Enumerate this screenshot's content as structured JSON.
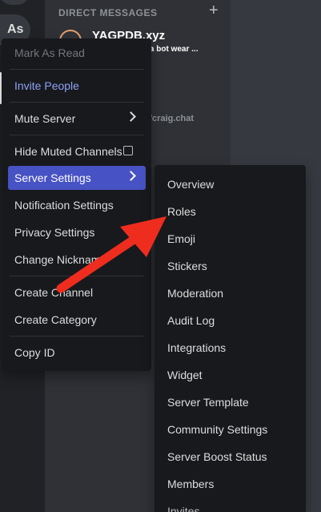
{
  "server_rail": {
    "server_initials": "As"
  },
  "dm_panel": {
    "header": "DIRECT MESSAGES",
    "add_icon": "plus-icon",
    "dm_name": "YAGPDB.xyz",
    "dm_status": "es a bot wear ...",
    "dm_link": "/craig.chat"
  },
  "context_menu": {
    "items": [
      {
        "label": "Mark As Read",
        "state": "disabled"
      },
      {
        "label": "Invite People",
        "state": "accent"
      },
      {
        "label": "Mute Server",
        "state": "normal",
        "trailing": "chevron-right-icon"
      },
      {
        "label": "Hide Muted Channels",
        "state": "normal",
        "trailing": "checkbox"
      },
      {
        "label": "Server Settings",
        "state": "active",
        "trailing": "chevron-right-icon"
      },
      {
        "label": "Notification Settings",
        "state": "normal"
      },
      {
        "label": "Privacy Settings",
        "state": "normal"
      },
      {
        "label": "Change Nickname",
        "state": "normal"
      },
      {
        "label": "Create Channel",
        "state": "normal"
      },
      {
        "label": "Create Category",
        "state": "normal"
      },
      {
        "label": "Copy ID",
        "state": "normal"
      }
    ]
  },
  "server_settings_submenu": {
    "items": [
      "Overview",
      "Roles",
      "Emoji",
      "Stickers",
      "Moderation",
      "Audit Log",
      "Integrations",
      "Widget",
      "Server Template",
      "Community Settings",
      "Server Boost Status",
      "Members",
      "Invites"
    ]
  },
  "annotation": {
    "arrow_color": "#ee2d1f",
    "points_to": "Roles"
  },
  "colors": {
    "accent": "#8ea1f7",
    "active_bg": "#4752c4",
    "menu_bg": "#18191c"
  }
}
